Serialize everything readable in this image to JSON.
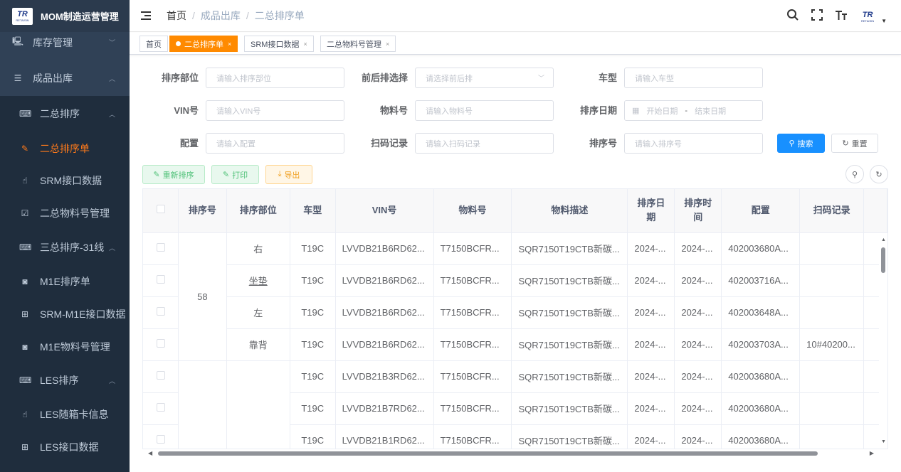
{
  "app": {
    "title": "MOM制造运营管理",
    "logo_text": "TR",
    "logo_sub": "RETAISIN"
  },
  "sidebar": {
    "items": [
      {
        "label": "库存管理",
        "icon": "monitor-icon",
        "glyph": "🖳"
      },
      {
        "label": "成品出库",
        "icon": "list-icon",
        "glyph": "☰"
      },
      {
        "label": "二总排序",
        "icon": "keyboard-icon",
        "glyph": "⌨"
      },
      {
        "label": "二总排序单",
        "icon": "edit-icon",
        "glyph": "✎"
      },
      {
        "label": "SRM接口数据",
        "icon": "hand-icon",
        "glyph": "☝"
      },
      {
        "label": "二总物料号管理",
        "icon": "checkbox-icon",
        "glyph": "☑"
      },
      {
        "label": "三总排序-31线",
        "icon": "keyboard-icon",
        "glyph": "⌨"
      },
      {
        "label": "M1E排序单",
        "icon": "radio-icon",
        "glyph": "◙"
      },
      {
        "label": "SRM-M1E接口数据",
        "icon": "table-icon",
        "glyph": "⊞"
      },
      {
        "label": "M1E物料号管理",
        "icon": "radio-icon",
        "glyph": "◙"
      },
      {
        "label": "LES排序",
        "icon": "keyboard-icon",
        "glyph": "⌨"
      },
      {
        "label": "LES随箱卡信息",
        "icon": "hand-icon",
        "glyph": "☝"
      },
      {
        "label": "LES接口数据",
        "icon": "table-icon",
        "glyph": "⊞"
      }
    ]
  },
  "breadcrumb": [
    "首页",
    "成品出库",
    "二总排序单"
  ],
  "tags": [
    {
      "label": "首页"
    },
    {
      "label": "二总排序单"
    },
    {
      "label": "SRM接口数据"
    },
    {
      "label": "二总物料号管理"
    }
  ],
  "form": {
    "dept": {
      "label": "排序部位",
      "placeholder": "请输入排序部位"
    },
    "front_rear": {
      "label": "前后排选择",
      "placeholder": "请选择前后排"
    },
    "car_model": {
      "label": "车型",
      "placeholder": "请输入车型"
    },
    "vin": {
      "label": "VIN号",
      "placeholder": "请输入VIN号"
    },
    "material": {
      "label": "物料号",
      "placeholder": "请输入物料号"
    },
    "date": {
      "label": "排序日期",
      "start": "开始日期",
      "sep": "-",
      "end": "结束日期"
    },
    "config": {
      "label": "配置",
      "placeholder": "请输入配置"
    },
    "scan": {
      "label": "扫码记录",
      "placeholder": "请输入扫码记录"
    },
    "seq": {
      "label": "排序号",
      "placeholder": "请输入排序号"
    },
    "search_btn": "搜索",
    "reset_btn": "重置"
  },
  "toolbar": {
    "resort": "重新排序",
    "print": "打印",
    "export": "导出"
  },
  "table": {
    "headers": [
      "排序号",
      "排序部位",
      "车型",
      "VIN号",
      "物料号",
      "物料描述",
      "排序日期",
      "排序时间",
      "配置",
      "扫码记录"
    ],
    "group_seq": "58",
    "rows": [
      {
        "dept": "右",
        "car": "T19C",
        "vin": "LVVDB21B6RD62...",
        "material": "T7150BCFR...",
        "desc": "SQR7150T19CTB新碳...",
        "date": "2024-...",
        "time": "2024-...",
        "config": "402003680A...",
        "scan": ""
      },
      {
        "dept": "坐垫",
        "car": "T19C",
        "vin": "LVVDB21B6RD62...",
        "material": "T7150BCFR...",
        "desc": "SQR7150T19CTB新碳...",
        "date": "2024-...",
        "time": "2024-...",
        "config": "402003716A...",
        "scan": ""
      },
      {
        "dept": "左",
        "car": "T19C",
        "vin": "LVVDB21B6RD62...",
        "material": "T7150BCFR...",
        "desc": "SQR7150T19CTB新碳...",
        "date": "2024-...",
        "time": "2024-...",
        "config": "402003648A...",
        "scan": ""
      },
      {
        "dept": "靠背",
        "car": "T19C",
        "vin": "LVVDB21B6RD62...",
        "material": "T7150BCFR...",
        "desc": "SQR7150T19CTB新碳...",
        "date": "2024-...",
        "time": "2024-...",
        "config": "402003703A...",
        "scan": "10#40200..."
      },
      {
        "dept": "",
        "car": "T19C",
        "vin": "LVVDB21B3RD62...",
        "material": "T7150BCFR...",
        "desc": "SQR7150T19CTB新碳...",
        "date": "2024-...",
        "time": "2024-...",
        "config": "402003680A...",
        "scan": ""
      },
      {
        "dept": "",
        "car": "T19C",
        "vin": "LVVDB21B7RD62...",
        "material": "T7150BCFR...",
        "desc": "SQR7150T19CTB新碳...",
        "date": "2024-...",
        "time": "2024-...",
        "config": "402003680A...",
        "scan": ""
      },
      {
        "dept": "",
        "car": "T19C",
        "vin": "LVVDB21B1RD62...",
        "material": "T7150BCFR...",
        "desc": "SQR7150T19CTB新碳...",
        "date": "2024-...",
        "time": "2024-...",
        "config": "402003680A...",
        "scan": ""
      }
    ]
  },
  "colors": {
    "sidebar_bg": "#304156",
    "accent": "#ff8a00",
    "primary": "#1890ff"
  }
}
